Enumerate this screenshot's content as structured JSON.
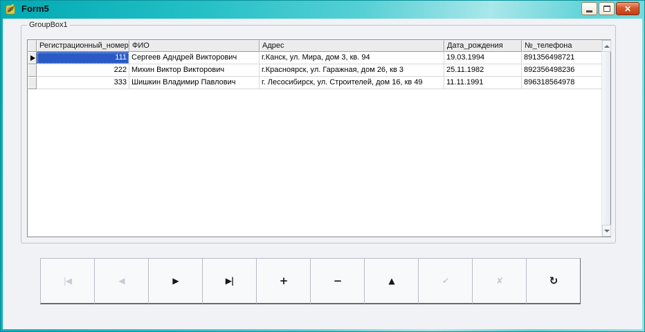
{
  "window": {
    "title": "Form5"
  },
  "titlebar": {
    "icons": [
      "app-icon",
      "minimize-icon",
      "maximize-icon",
      "close-icon"
    ]
  },
  "groupbox": {
    "label": "GroupBox1"
  },
  "grid": {
    "columns": [
      "Регистрационный_номер",
      "ФИО",
      "Адрес",
      "Дата_рождения",
      "№_телефона"
    ],
    "rows": [
      [
        "111",
        "Сергеев Адндрей Викторович",
        "г.Канск, ул. Мира, дом 3, кв. 94",
        "19.03.1994",
        "891356498721"
      ],
      [
        "222",
        "Михин Виктор Викторович",
        "г.Красноярск, ул. Гаражная, дом 26, кв 3",
        "25.11.1982",
        "892356498236"
      ],
      [
        "333",
        "Шишкин Владимир Павлович",
        "г. Лесосибирск, ул. Строителей, дом 16, кв 49",
        "11.11.1991",
        "896318564978"
      ]
    ],
    "selected_cell": {
      "row": 0,
      "column": "Регистрационный_номер",
      "value": "111"
    },
    "selection_color": "#2a5ac4",
    "scrollbar_icons": [
      "up-arrow-icon",
      "down-arrow-icon"
    ]
  },
  "navigator": {
    "buttons": [
      {
        "name": "first",
        "icon": "first-record-icon",
        "glyph": "|◀",
        "enabled": false
      },
      {
        "name": "prior",
        "icon": "prior-record-icon",
        "glyph": "◀",
        "enabled": false
      },
      {
        "name": "next",
        "icon": "next-record-icon",
        "glyph": "▶",
        "enabled": true
      },
      {
        "name": "last",
        "icon": "last-record-icon",
        "glyph": "▶|",
        "enabled": true
      },
      {
        "name": "insert",
        "icon": "insert-record-icon",
        "glyph": "+",
        "enabled": true
      },
      {
        "name": "delete",
        "icon": "delete-record-icon",
        "glyph": "−",
        "enabled": true
      },
      {
        "name": "edit",
        "icon": "edit-record-icon",
        "glyph": "▲",
        "enabled": true
      },
      {
        "name": "post",
        "icon": "post-edit-icon",
        "glyph": "✔",
        "enabled": false
      },
      {
        "name": "cancel",
        "icon": "cancel-edit-icon",
        "glyph": "✘",
        "enabled": false
      },
      {
        "name": "refresh",
        "icon": "refresh-data-icon",
        "glyph": "↻",
        "enabled": true
      }
    ]
  }
}
